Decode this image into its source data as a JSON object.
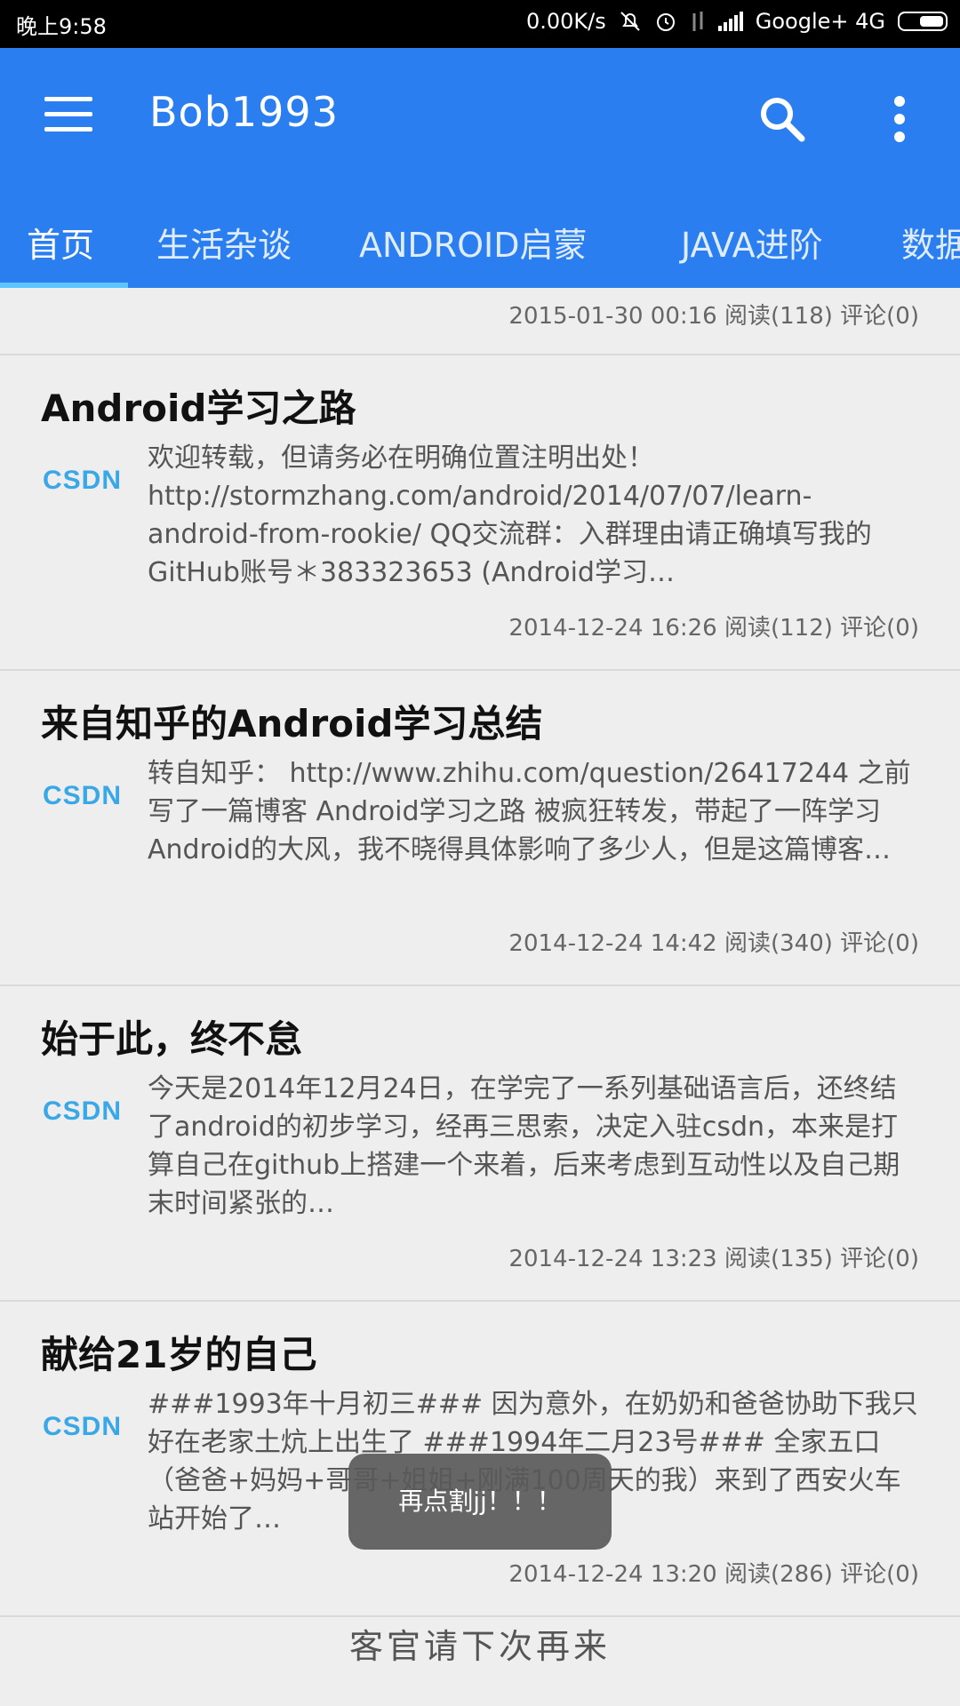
{
  "status_bar": {
    "time": "晚上9:58",
    "speed": "0.00K/s",
    "carrier": "Google+ 4G"
  },
  "app_bar": {
    "title": "Bob1993"
  },
  "tabs": [
    {
      "label": "首页",
      "active": true
    },
    {
      "label": "生活杂谈",
      "active": false
    },
    {
      "label": "ANDROID启蒙",
      "active": false
    },
    {
      "label": "JAVA进阶",
      "active": false
    },
    {
      "label": "数据",
      "active": false
    }
  ],
  "first_meta": "2015-01-30 00:16 阅读(118) 评论(0)",
  "articles": [
    {
      "title": "Android学习之路",
      "logo": "CSDN",
      "summary": "欢迎转载，但请务必在明确位置注明出处！http://stormzhang.com/android/2014/07/07/learn-android-from-rookie/ QQ交流群：入群理由请正确填写我的GitHub账号＊383323653 (Android学习…",
      "meta": "2014-12-24 16:26 阅读(112) 评论(0)"
    },
    {
      "title": "来自知乎的Android学习总结",
      "logo": "CSDN",
      "summary": "转自知乎： http://www.zhihu.com/question/26417244 之前写了一篇博客 Android学习之路 被疯狂转发，带起了一阵学习Android的大风，我不晓得具体影响了多少人，但是这篇博客…",
      "meta": "2014-12-24 14:42 阅读(340) 评论(0)"
    },
    {
      "title": "始于此，终不怠",
      "logo": "CSDN",
      "summary": "今天是2014年12月24日，在学完了一系列基础语言后，还终结了android的初步学习，经再三思索，决定入驻csdn，本来是打算自己在github上搭建一个来着，后来考虑到互动性以及自己期末时间紧张的…",
      "meta": "2014-12-24 13:23 阅读(135) 评论(0)"
    },
    {
      "title": "献给21岁的自己",
      "logo": "CSDN",
      "summary": "###1993年十月初三### 因为意外，在奶奶和爸爸协助下我只好在老家土炕上出生了 ###1994年二月23号### 全家五口（爸爸+妈妈+哥哥+姐姐+刚满100周天的我）来到了西安火车站开始了…",
      "meta": "2014-12-24 13:20 阅读(286) 评论(0)"
    }
  ],
  "footer_text": "客官请下次再来",
  "toast_text": "再点割jj！！！",
  "colors": {
    "primary": "#2a7ef0",
    "indicator": "#5bc5ff",
    "csdn": "#3aa7e6"
  },
  "icons": [
    "menu-icon",
    "search-icon",
    "more-vert-icon"
  ]
}
